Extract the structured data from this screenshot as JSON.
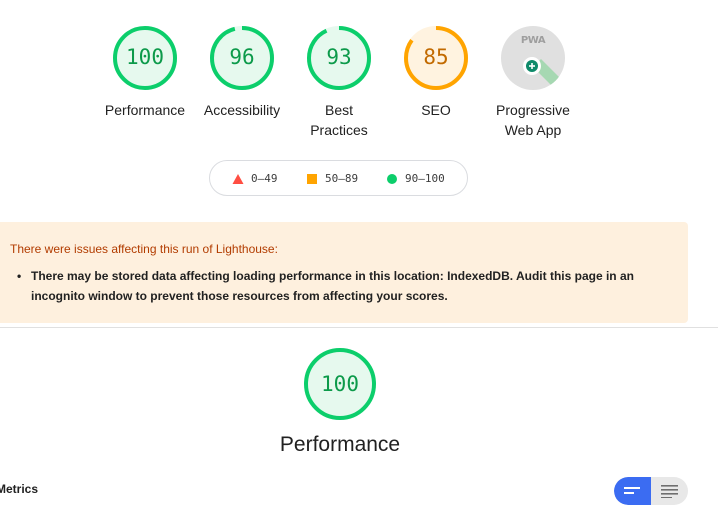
{
  "gauges": [
    {
      "score": "100",
      "label_line1": "Performance",
      "label_line2": "",
      "status": "pass",
      "fraction": 1.0
    },
    {
      "score": "96",
      "label_line1": "Accessibility",
      "label_line2": "",
      "status": "pass",
      "fraction": 0.96
    },
    {
      "score": "93",
      "label_line1": "Best",
      "label_line2": "Practices",
      "status": "pass",
      "fraction": 0.93
    },
    {
      "score": "85",
      "label_line1": "SEO",
      "label_line2": "",
      "status": "average",
      "fraction": 0.85
    },
    {
      "label_line1": "Progressive",
      "label_line2": "Web App",
      "badge_text": "PWA",
      "status": "pwa"
    }
  ],
  "legend": {
    "fail": "0–49",
    "average": "50–89",
    "pass": "90–100"
  },
  "warning": {
    "title": "There were issues affecting this run of Lighthouse:",
    "items": [
      "There may be stored data affecting loading performance in this location: IndexedDB. Audit this page in an incognito window to prevent those resources from affecting your scores."
    ]
  },
  "category": {
    "score": "100",
    "title": "Performance",
    "fraction": 1.0
  },
  "metrics_label": "Metrics",
  "colors": {
    "pass": "#0cce6b",
    "pass_bg": "#e6f9ee",
    "average": "#ffa400",
    "average_bg": "#fff3e0",
    "fail": "#ff4e42",
    "toggle_active": "#3b6cf2"
  },
  "icons": {
    "toggle_left": "list-view-icon",
    "toggle_right": "detail-view-icon"
  }
}
